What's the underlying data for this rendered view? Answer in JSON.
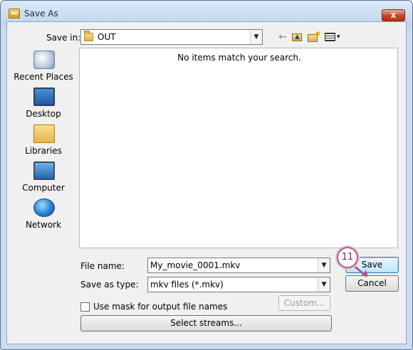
{
  "window": {
    "title": "Save As",
    "close_glyph": "x"
  },
  "toolbar": {
    "save_in_label": "Save in:",
    "location": "OUT",
    "back_glyph": "←",
    "up_glyph": "▲",
    "new_folder_glyph": "✱",
    "views_glyph": "▾",
    "dropdown_glyph": "▼",
    "icons": [
      "folder-icon",
      "back-arrow-icon",
      "up-folder-icon",
      "new-folder-icon",
      "views-menu-icon"
    ]
  },
  "places": [
    {
      "label": "Recent Places",
      "icon": "recent-places-icon"
    },
    {
      "label": "Desktop",
      "icon": "desktop-icon"
    },
    {
      "label": "Libraries",
      "icon": "libraries-icon"
    },
    {
      "label": "Computer",
      "icon": "computer-icon"
    },
    {
      "label": "Network",
      "icon": "network-icon"
    }
  ],
  "file_list": {
    "empty_message": "No items match your search."
  },
  "form": {
    "file_name_label": "File name:",
    "file_name_value": "My_movie_0001.mkv",
    "save_as_type_label": "Save as type:",
    "save_as_type_value": "mkv files (*.mkv)",
    "use_mask_label": "Use mask for output file names",
    "use_mask_checked": false
  },
  "buttons": {
    "save": "Save",
    "cancel": "Cancel",
    "custom": "Custom...",
    "select_streams": "Select streams..."
  },
  "annotation": {
    "step_number": "11"
  },
  "colors": {
    "titlebar": "#c9dcf2",
    "close_button": "#c7432b",
    "default_button": "#bee6fd",
    "callout": "#b05a86"
  }
}
